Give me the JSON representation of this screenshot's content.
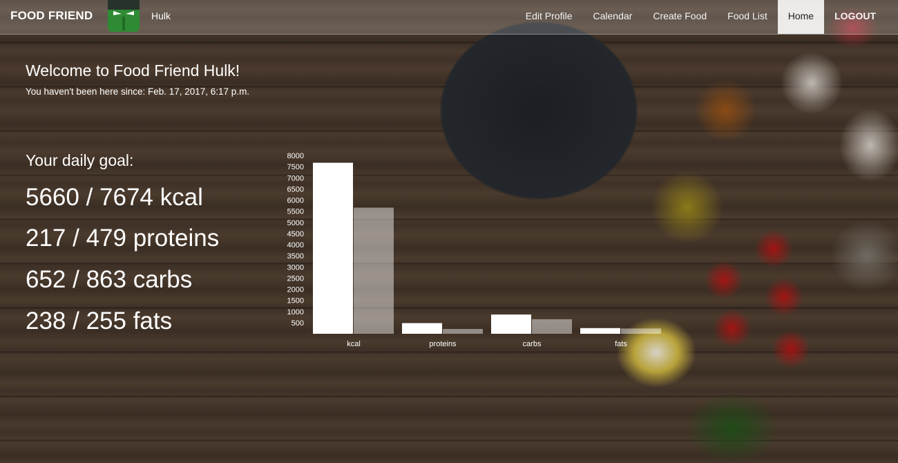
{
  "navbar": {
    "brand": "FOOD FRIEND",
    "logo_icon": "hulk-face-icon",
    "username": "Hulk",
    "items": [
      {
        "label": "Edit Profile",
        "active": false
      },
      {
        "label": "Calendar",
        "active": false
      },
      {
        "label": "Create Food",
        "active": false
      },
      {
        "label": "Food List",
        "active": false
      },
      {
        "label": "Home",
        "active": true
      },
      {
        "label": "LOGOUT",
        "active": false
      }
    ]
  },
  "welcome": {
    "title": "Welcome to Food Friend Hulk!",
    "since": "You haven't been here since: Feb. 17, 2017, 6:17 p.m."
  },
  "goals": {
    "heading": "Your daily goal:",
    "lines": [
      "5660 / 7674 kcal",
      "217 / 479 proteins",
      "652 / 863 carbs",
      "238 / 255 fats"
    ]
  },
  "chart_data": {
    "type": "bar",
    "categories": [
      "kcal",
      "proteins",
      "carbs",
      "fats"
    ],
    "series": [
      {
        "values": [
          7674,
          479,
          863,
          255
        ],
        "color": "#ffffff"
      },
      {
        "values": [
          5660,
          217,
          652,
          238
        ],
        "color": "rgba(255,255,255,0.45)"
      }
    ],
    "ylim": [
      0,
      8000
    ],
    "yticks": [
      500,
      1000,
      1500,
      2000,
      2500,
      3000,
      3500,
      4000,
      4500,
      5000,
      5500,
      6000,
      6500,
      7000,
      7500,
      8000
    ],
    "grid": false,
    "legend": "none"
  }
}
